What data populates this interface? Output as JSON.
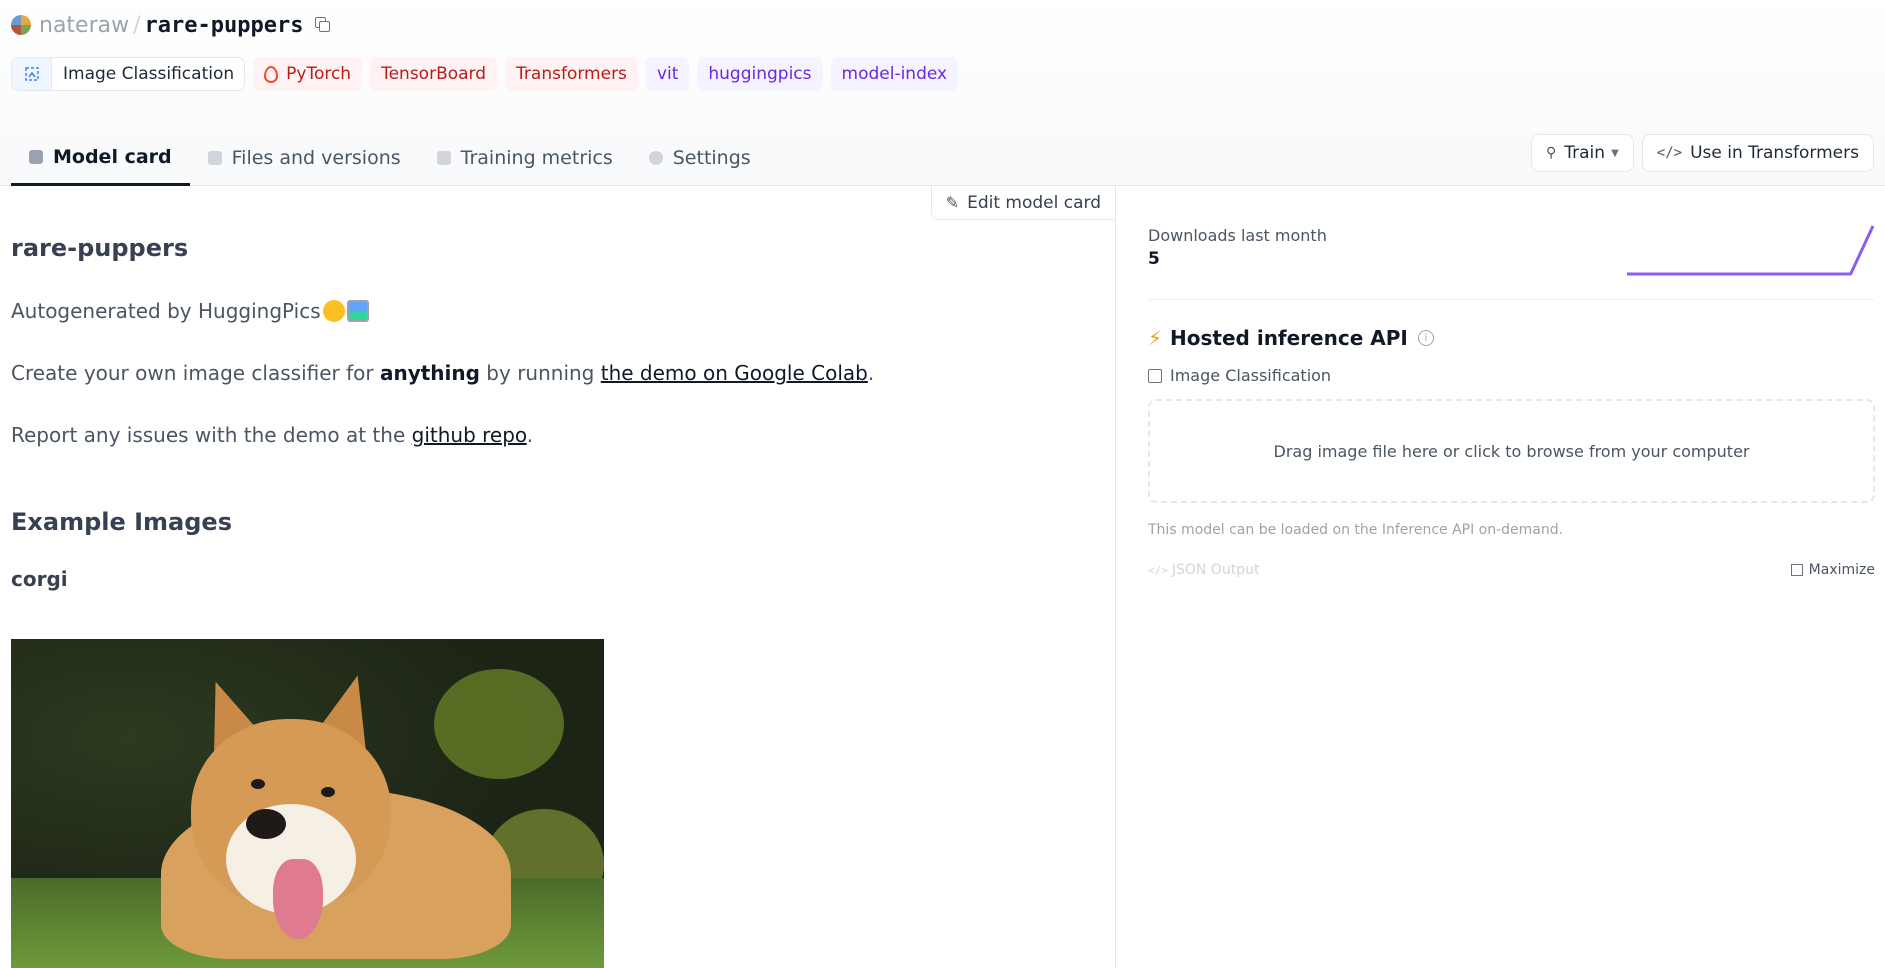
{
  "repo": {
    "owner": "nateraw",
    "separator": "/",
    "name": "rare-puppers"
  },
  "tags": [
    {
      "label": "Image Classification"
    },
    {
      "label": "PyTorch"
    },
    {
      "label": "TensorBoard"
    },
    {
      "label": "Transformers"
    },
    {
      "label": "vit"
    },
    {
      "label": "huggingpics"
    },
    {
      "label": "model-index"
    }
  ],
  "tabs": [
    {
      "label": "Model card"
    },
    {
      "label": "Files and versions"
    },
    {
      "label": "Training metrics"
    },
    {
      "label": "Settings"
    }
  ],
  "actions": {
    "train": "Train",
    "use_in": "Use in Transformers"
  },
  "model_card": {
    "edit_label": "Edit model card",
    "title": "rare-puppers",
    "autogen": "Autogenerated by HuggingPics",
    "create_prefix": "Create your own image classifier for ",
    "create_bold": "anything",
    "create_mid": " by running ",
    "create_link": "the demo on Google Colab",
    "create_suffix": ".",
    "report_prefix": "Report any issues with the demo at the ",
    "report_link": "github repo",
    "report_suffix": ".",
    "examples_heading": "Example Images",
    "example_label": "corgi"
  },
  "sidebar": {
    "downloads_label": "Downloads last month",
    "downloads_value": "5",
    "api_title": "Hosted inference API",
    "api_task": "Image Classification",
    "dropzone": "Drag image file here or click to browse from your computer",
    "note": "This model can be loaded on the Inference API on-demand.",
    "json_output": "JSON Output",
    "maximize": "Maximize"
  },
  "colors": {
    "accent": "#8b5cf6",
    "tag_red": "#b91c1c",
    "tag_purple": "#6d28d9"
  },
  "chart_data": {
    "type": "line",
    "series": [
      {
        "values": [
          0,
          0,
          0,
          0,
          0,
          0,
          0,
          0,
          0,
          0,
          0,
          5
        ]
      }
    ]
  }
}
